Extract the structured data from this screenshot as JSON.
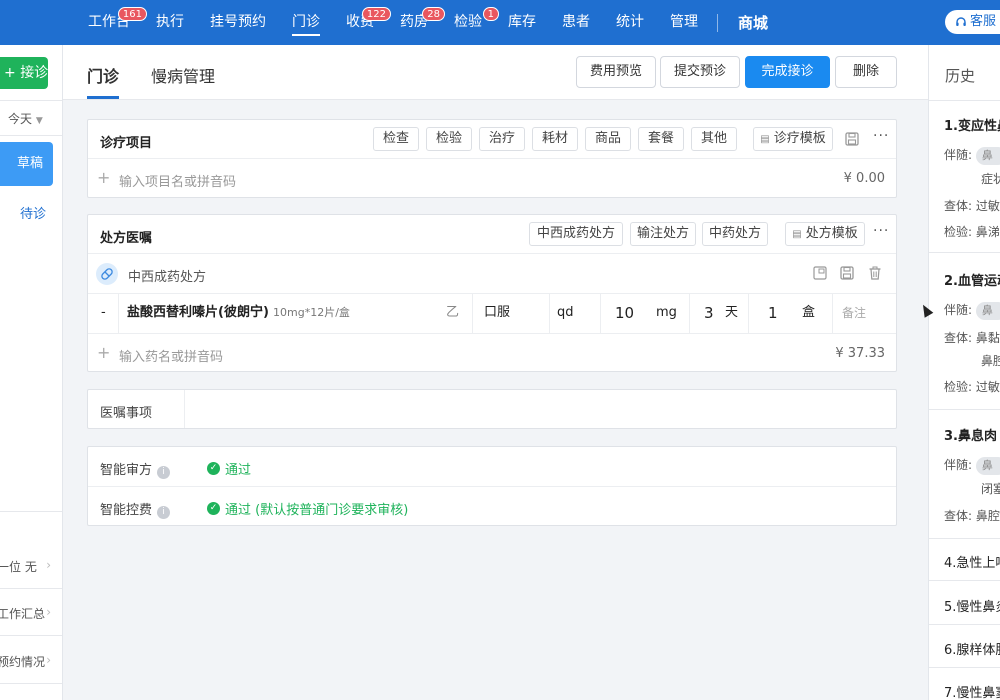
{
  "nav": {
    "items": [
      {
        "label": "工作台",
        "badge": "161",
        "active": false
      },
      {
        "label": "执行",
        "badge": "",
        "active": false
      },
      {
        "label": "挂号预约",
        "badge": "",
        "active": false
      },
      {
        "label": "门诊",
        "badge": "",
        "active": true
      },
      {
        "label": "收费",
        "badge": "122",
        "active": false
      },
      {
        "label": "药房",
        "badge": "28",
        "active": false
      },
      {
        "label": "检验",
        "badge": "1",
        "active": false
      },
      {
        "label": "库存",
        "badge": "",
        "active": false
      },
      {
        "label": "患者",
        "badge": "",
        "active": false
      },
      {
        "label": "统计",
        "badge": "",
        "active": false
      },
      {
        "label": "管理",
        "badge": "",
        "active": false
      }
    ],
    "mall": "商城",
    "service": "客服"
  },
  "left": {
    "jiezhen": "接诊",
    "date_filter": "今天",
    "draft": "草稿",
    "pending": "待诊",
    "links": [
      "一位 无",
      "工作汇总",
      "预约情况"
    ]
  },
  "header": {
    "tabs": [
      "门诊",
      "慢病管理"
    ],
    "buttons": {
      "fee_preview": "费用预览",
      "submit_pre": "提交预诊",
      "complete": "完成接诊",
      "delete": "删除"
    }
  },
  "treatment": {
    "title": "诊疗项目",
    "buttons": [
      "检查",
      "检验",
      "治疗",
      "耗材",
      "商品",
      "套餐",
      "其他"
    ],
    "template": "诊疗模板",
    "placeholder": "输入项目名或拼音码",
    "price": "¥ 0.00"
  },
  "prescription": {
    "title": "处方医嘱",
    "buttons": [
      "中西成药处方",
      "输注处方",
      "中药处方"
    ],
    "template": "处方模板",
    "sub_title": "中西成药处方",
    "row": {
      "index": "-",
      "drug_name": "盐酸西替利嗪片(彼朗宁)",
      "spec": "10mg*12片/盒",
      "grade": "乙",
      "usage": "口服",
      "freq": "qd",
      "dose": "10",
      "dose_unit": "mg",
      "days": "3",
      "days_unit": "天",
      "qty": "1",
      "qty_unit": "盒",
      "remark": "备注"
    },
    "placeholder": "输入药名或拼音码",
    "price": "¥ 37.33"
  },
  "orders": {
    "label": "医嘱事项"
  },
  "smart": {
    "review_label": "智能审方",
    "review_result": "通过",
    "fee_label": "智能控费",
    "fee_result": "通过 (默认按普通门诊要求审核)"
  },
  "history": {
    "title": "历史",
    "entries": [
      {
        "title": "1.变应性鼻",
        "lines": [
          {
            "label": "伴随:",
            "value": "鼻"
          },
          {
            "label": "",
            "value": "症状"
          },
          {
            "label": "查体:",
            "value": "过敏"
          },
          {
            "label": "检验:",
            "value": "鼻涕"
          }
        ]
      },
      {
        "title": "2.血管运动",
        "lines": [
          {
            "label": "伴随:",
            "value": "鼻"
          },
          {
            "label": "查体:",
            "value": "鼻黏"
          },
          {
            "label": "",
            "value": "鼻腔"
          },
          {
            "label": "检验:",
            "value": "过敏"
          }
        ]
      },
      {
        "title": "3.鼻息肉",
        "lines": [
          {
            "label": "伴随:",
            "value": "鼻"
          },
          {
            "label": "",
            "value": "闭塞"
          },
          {
            "label": "查体:",
            "value": "鼻腔"
          }
        ]
      },
      {
        "title": "4.急性上呼",
        "lines": []
      },
      {
        "title": "5.慢性鼻炎",
        "lines": []
      },
      {
        "title": "6.腺样体肥",
        "lines": []
      },
      {
        "title": "7.慢性鼻窦",
        "lines": []
      }
    ]
  }
}
